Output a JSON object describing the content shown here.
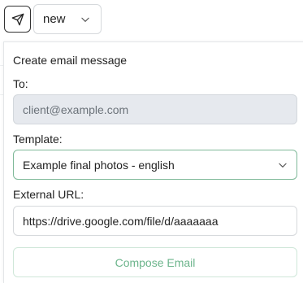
{
  "toolbar": {
    "send_icon": "paper-plane-icon",
    "status_value": "new",
    "status_icon": "chevron-down-icon"
  },
  "popover": {
    "title": "Create email message",
    "to_label": "To:",
    "to_value": "client@example.com",
    "template_label": "Template:",
    "template_value": "Example final photos - english",
    "template_icon": "chevron-down-icon",
    "url_label": "External URL:",
    "url_value": "https://drive.google.com/file/d/aaaaaaa",
    "compose_label": "Compose Email"
  },
  "colors": {
    "accent": "#6db58c",
    "select_border": "#7fb999",
    "disabled_bg": "#e6e9ee"
  }
}
